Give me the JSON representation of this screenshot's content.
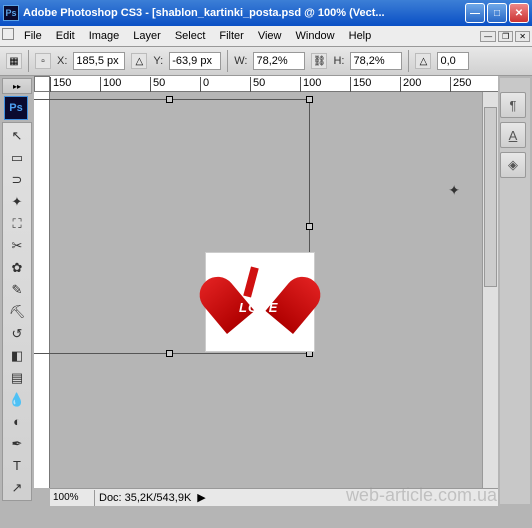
{
  "titlebar": {
    "app_icon_text": "Ps",
    "title": "Adobe Photoshop CS3 - [shablon_kartinki_posta.psd @ 100% (Vect..."
  },
  "menubar": {
    "items": [
      "File",
      "Edit",
      "Image",
      "Layer",
      "Select",
      "Filter",
      "View",
      "Window",
      "Help"
    ]
  },
  "options": {
    "x_label": "X:",
    "x_value": "185,5 px",
    "y_label": "Y:",
    "y_value": "-63,9 px",
    "w_label": "W:",
    "w_value": "78,2%",
    "h_label": "H:",
    "h_value": "78,2%",
    "a_label": "",
    "a_value": "0,0"
  },
  "ruler_h": {
    "m150": "150",
    "m100": "100",
    "m50": "50",
    "z": "0",
    "p50": "50",
    "p100": "100",
    "p150": "150",
    "p200": "200",
    "p250": "250"
  },
  "image": {
    "love_text": "LOVE"
  },
  "status": {
    "zoom": "100%",
    "doc_label": "Doc:",
    "doc_value": "35,2K/543,9K"
  },
  "ps_logo_text": "Ps",
  "watermark": "web-article.com.ua"
}
